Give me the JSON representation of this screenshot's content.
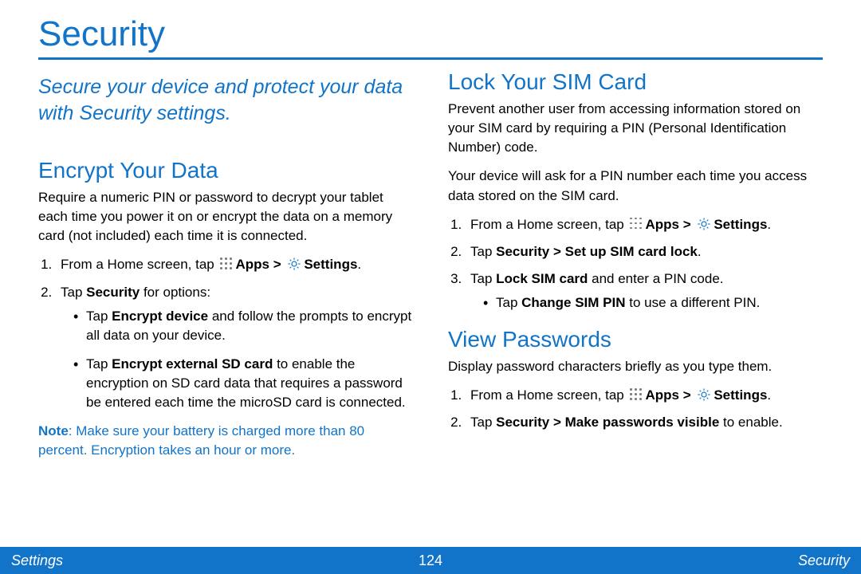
{
  "title": "Security",
  "lead": "Secure your device and protect your data with Security settings.",
  "inline": {
    "from_home_prefix": "From a Home screen, tap ",
    "apps_label": "Apps",
    "gt": " > ",
    "settings_label": "Settings",
    "period": "."
  },
  "encrypt": {
    "heading": "Encrypt Your Data",
    "intro": "Require a numeric PIN or password to decrypt your tablet each time you power it on or encrypt the data on a memory card (not included) each time it is connected.",
    "step2_prefix": "Tap ",
    "step2_bold": "Security",
    "step2_suffix": " for options:",
    "b1_prefix": "Tap ",
    "b1_bold": "Encrypt device",
    "b1_suffix": " and follow the prompts to encrypt all data on your device.",
    "b2_prefix": "Tap ",
    "b2_bold": "Encrypt external SD card",
    "b2_suffix": " to enable the encryption on SD card data that requires a password be entered each time the microSD card is connected.",
    "note_label": "Note",
    "note_text": ": Make sure your battery is charged more than 80 percent. Encryption takes an hour or more."
  },
  "sim": {
    "heading": "Lock Your SIM Card",
    "p1": "Prevent another user from accessing information stored on your SIM card by requiring a PIN (Personal Identification Number) code.",
    "p2": "Your device will ask for a PIN number each time you access data stored on the SIM card.",
    "step2_prefix": "Tap ",
    "step2_bold": "Security > Set up SIM card lock",
    "step3_prefix": "Tap ",
    "step3_bold": "Lock SIM card",
    "step3_suffix": " and enter a PIN code.",
    "sub_prefix": "Tap ",
    "sub_bold": "Change SIM PIN",
    "sub_suffix": " to use a different PIN."
  },
  "view": {
    "heading": "View Passwords",
    "p1": "Display password characters briefly as you type them.",
    "step2_prefix": "Tap ",
    "step2_bold": "Security > Make passwords visible",
    "step2_suffix": " to enable."
  },
  "footer": {
    "left": "Settings",
    "center": "124",
    "right": "Security"
  }
}
